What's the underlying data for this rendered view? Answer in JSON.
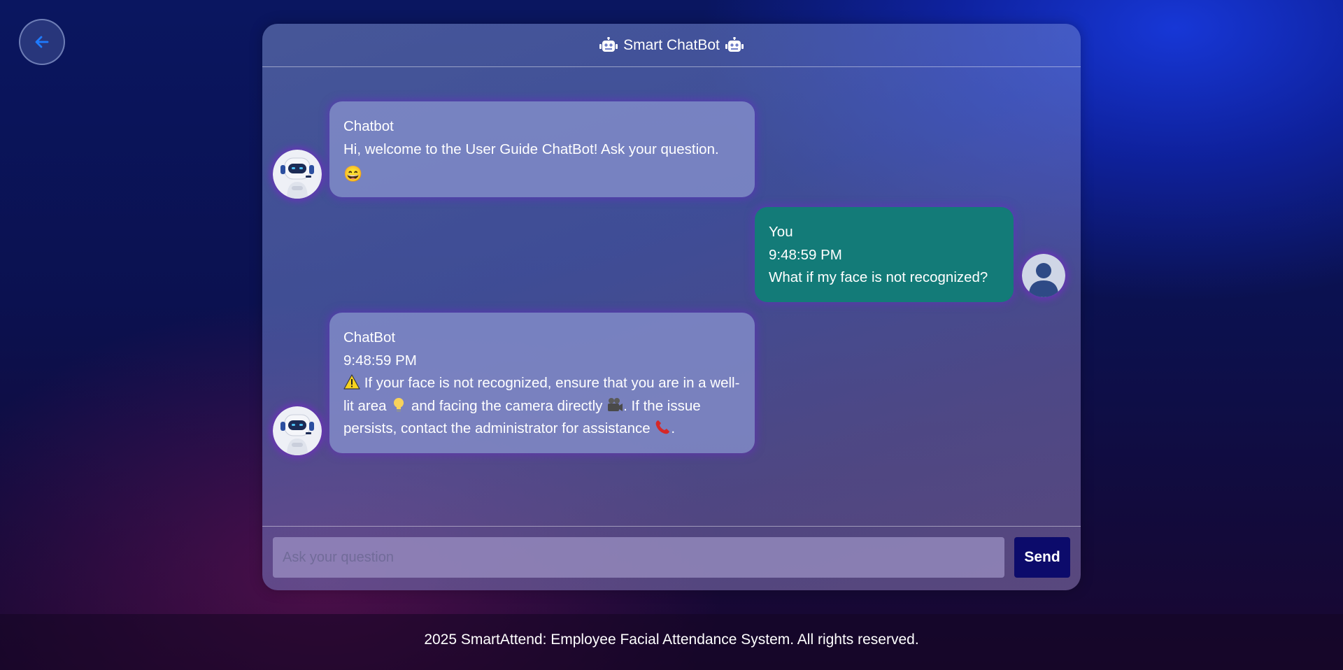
{
  "header": {
    "title": "Smart ChatBot",
    "icon": "robot-icon"
  },
  "messages": [
    {
      "sender": "Chatbot",
      "time": "",
      "text": "Hi, welcome to the User Guide ChatBot! Ask your question.",
      "emoji": "😄",
      "side": "left",
      "avatar": "robot-avatar"
    },
    {
      "sender": "You",
      "time": "9:48:59 PM",
      "text": "What if my face is not recognized?",
      "side": "right",
      "avatar": "user-avatar"
    },
    {
      "sender": "ChatBot",
      "time": "9:48:59 PM",
      "text_parts": [
        "If your face is not recognized, ensure that you are in a well-lit area",
        "and facing the camera directly",
        ". If the issue persists, contact the administrator for assistance",
        "."
      ],
      "emojis": [
        "⚠️",
        "💡",
        "🎥",
        "📞"
      ],
      "side": "left",
      "avatar": "robot-avatar"
    }
  ],
  "input": {
    "placeholder": "Ask your question",
    "value": ""
  },
  "send_label": "Send",
  "back_icon": "arrow-left-icon",
  "footer": {
    "text": "2025 SmartAttend: Employee Facial Attendance System. All rights reserved."
  },
  "colors": {
    "user_bubble": "#137b78",
    "send_button": "#0c0b6b",
    "back_arrow": "#1e7bff"
  }
}
